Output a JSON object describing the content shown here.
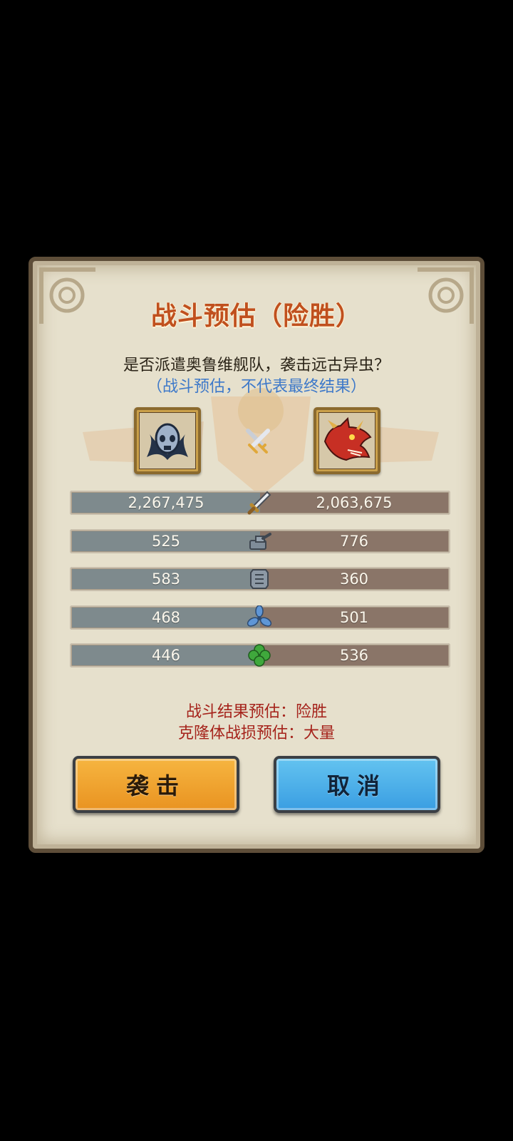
{
  "dialog": {
    "title": "战斗预估（险胜）",
    "question": "是否派遣奥鲁维舰队，袭击远古异虫？",
    "note": "（战斗预估，不代表最终结果）",
    "left_portrait_icon": "masked-skull-fleet-icon",
    "right_portrait_icon": "red-dragon-icon",
    "vs_icon": "crossed-swords-icon"
  },
  "stats": [
    {
      "icon": "sword-icon",
      "left": "2,267,475",
      "right": "2,063,675"
    },
    {
      "icon": "cannon-icon",
      "left": "525",
      "right": "776"
    },
    {
      "icon": "armor-plate-icon",
      "left": "583",
      "right": "360"
    },
    {
      "icon": "propeller-icon",
      "left": "468",
      "right": "501"
    },
    {
      "icon": "clover-icon",
      "left": "446",
      "right": "536"
    }
  ],
  "result": {
    "outcome": "战斗结果预估：险胜",
    "losses": "克隆体战损预估：大量"
  },
  "buttons": {
    "attack": "袭击",
    "cancel": "取消"
  },
  "colors": {
    "title": "#c0501e",
    "note": "#3e79c9",
    "result": "#a5231b",
    "attack_button": "#f0a530",
    "cancel_button": "#4ab0ea"
  }
}
